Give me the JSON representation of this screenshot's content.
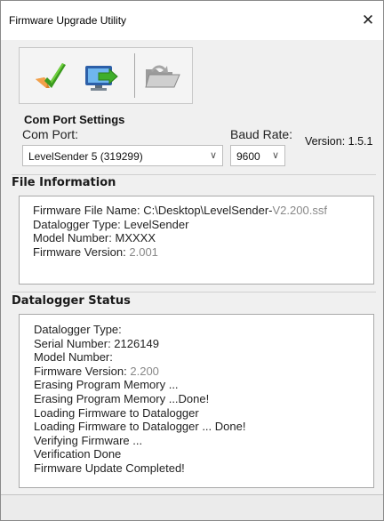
{
  "window": {
    "title": "Firmware Upgrade Utility",
    "close_label": "✕"
  },
  "toolbar": {
    "buttons": [
      {
        "name": "check-firmware-button",
        "icon": "checkmark-icon"
      },
      {
        "name": "upload-to-device-button",
        "icon": "monitor-transfer-icon"
      },
      {
        "name": "open-folder-button",
        "icon": "folder-open-icon"
      }
    ]
  },
  "com_port_settings": {
    "title": "Com Port Settings",
    "com_port_label": "Com Port:",
    "com_port_value": "LevelSender 5 (319299)",
    "baud_rate_label": "Baud Rate:",
    "baud_rate_value": "9600",
    "version_text": "Version:",
    "version_number": "1.5.1"
  },
  "file_information": {
    "title": "File Information",
    "lines": [
      {
        "label": "Firmware File Name:",
        "value": "C:\\Desktop\\LevelSender-",
        "value_gray": "V2.200.ssf"
      },
      {
        "label": "Datalogger Type:",
        "value": "LevelSender",
        "value_gray": ""
      },
      {
        "label": "Model Number:",
        "value": "MXXXX",
        "value_gray": ""
      },
      {
        "label": "Firmware Version:",
        "value": "",
        "value_gray": "2.001"
      }
    ]
  },
  "datalogger_status": {
    "title": "Datalogger Status",
    "lines": [
      {
        "text": "Datalogger Type:",
        "gray": ""
      },
      {
        "text": "Serial Number: 2126149",
        "gray": ""
      },
      {
        "text": "Model Number:",
        "gray": ""
      },
      {
        "text": "Firmware Version:",
        "gray": "2.200"
      },
      {
        "text": "Erasing Program Memory ...",
        "gray": ""
      },
      {
        "text": "Erasing Program Memory ...Done!",
        "gray": ""
      },
      {
        "text": "Loading Firmware to Datalogger",
        "gray": ""
      },
      {
        "text": "Loading Firmware to Datalogger ... Done!",
        "gray": ""
      },
      {
        "text": "Verifying Firmware ...",
        "gray": ""
      },
      {
        "text": "Verification Done",
        "gray": ""
      },
      {
        "text": "Firmware Update Completed!",
        "gray": ""
      }
    ]
  },
  "colors": {
    "window_bg": "#f0f0f0",
    "panel_bg": "#ffffff",
    "gray_text": "#888888",
    "checkmark_green": "#3a9a1e",
    "arrow_orange": "#e07a1f"
  }
}
